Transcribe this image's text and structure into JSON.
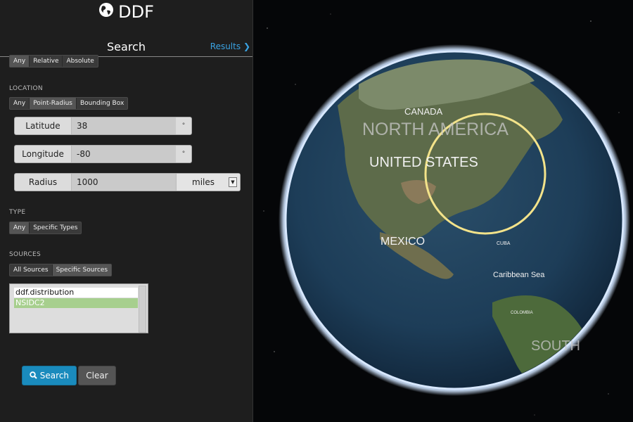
{
  "app": {
    "title": "DDF"
  },
  "nav": {
    "title": "Search",
    "results_label": "Results"
  },
  "time": {
    "options": [
      "Any",
      "Relative",
      "Absolute"
    ]
  },
  "location": {
    "heading": "LOCATION",
    "modes": [
      "Any",
      "Point-Radius",
      "Bounding Box"
    ],
    "latitude": {
      "label": "Latitude",
      "value": "38",
      "unit": "°"
    },
    "longitude": {
      "label": "Longitude",
      "value": "-80",
      "unit": "°"
    },
    "radius": {
      "label": "Radius",
      "value": "1000",
      "unit": "miles"
    }
  },
  "type": {
    "heading": "TYPE",
    "options": [
      "Any",
      "Specific Types"
    ]
  },
  "sources": {
    "heading": "SOURCES",
    "options": [
      "All Sources",
      "Specific Sources"
    ],
    "list": [
      "ddf.distribution",
      "NSIDC2"
    ]
  },
  "actions": {
    "search_label": "Search",
    "clear_label": "Clear"
  },
  "map": {
    "labels": [
      "CANADA",
      "NORTH AMERICA",
      "UNITED STATES",
      "MEXICO",
      "Caribbean Sea",
      "CUBA",
      "COLOMBIA",
      "SOUTH"
    ]
  },
  "colors": {
    "accent": "#3aa3e3",
    "search_button": "#1a8bbd",
    "selected_source": "#a7cf8e",
    "search_ring": "#f3e38a"
  },
  "icons": {
    "brand": "globe-icon",
    "results": "chevron-right-icon",
    "search": "search-icon",
    "dropdown": "dropdown-arrow-icon"
  }
}
